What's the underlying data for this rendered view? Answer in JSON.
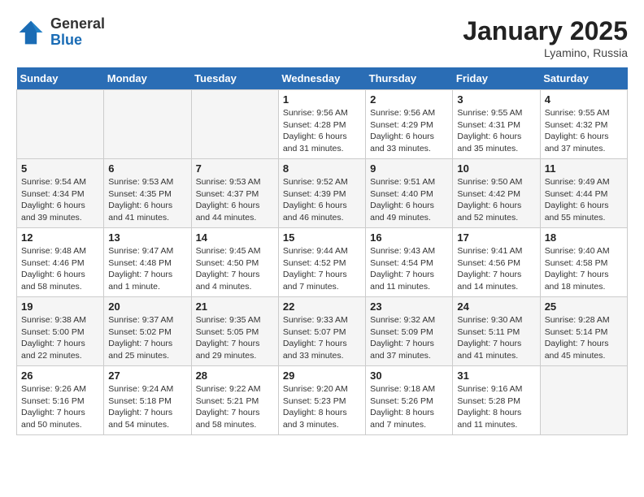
{
  "header": {
    "logo_general": "General",
    "logo_blue": "Blue",
    "month": "January 2025",
    "location": "Lyamino, Russia"
  },
  "weekdays": [
    "Sunday",
    "Monday",
    "Tuesday",
    "Wednesday",
    "Thursday",
    "Friday",
    "Saturday"
  ],
  "weeks": [
    [
      {
        "day": "",
        "info": ""
      },
      {
        "day": "",
        "info": ""
      },
      {
        "day": "",
        "info": ""
      },
      {
        "day": "1",
        "info": "Sunrise: 9:56 AM\nSunset: 4:28 PM\nDaylight: 6 hours\nand 31 minutes."
      },
      {
        "day": "2",
        "info": "Sunrise: 9:56 AM\nSunset: 4:29 PM\nDaylight: 6 hours\nand 33 minutes."
      },
      {
        "day": "3",
        "info": "Sunrise: 9:55 AM\nSunset: 4:31 PM\nDaylight: 6 hours\nand 35 minutes."
      },
      {
        "day": "4",
        "info": "Sunrise: 9:55 AM\nSunset: 4:32 PM\nDaylight: 6 hours\nand 37 minutes."
      }
    ],
    [
      {
        "day": "5",
        "info": "Sunrise: 9:54 AM\nSunset: 4:34 PM\nDaylight: 6 hours\nand 39 minutes."
      },
      {
        "day": "6",
        "info": "Sunrise: 9:53 AM\nSunset: 4:35 PM\nDaylight: 6 hours\nand 41 minutes."
      },
      {
        "day": "7",
        "info": "Sunrise: 9:53 AM\nSunset: 4:37 PM\nDaylight: 6 hours\nand 44 minutes."
      },
      {
        "day": "8",
        "info": "Sunrise: 9:52 AM\nSunset: 4:39 PM\nDaylight: 6 hours\nand 46 minutes."
      },
      {
        "day": "9",
        "info": "Sunrise: 9:51 AM\nSunset: 4:40 PM\nDaylight: 6 hours\nand 49 minutes."
      },
      {
        "day": "10",
        "info": "Sunrise: 9:50 AM\nSunset: 4:42 PM\nDaylight: 6 hours\nand 52 minutes."
      },
      {
        "day": "11",
        "info": "Sunrise: 9:49 AM\nSunset: 4:44 PM\nDaylight: 6 hours\nand 55 minutes."
      }
    ],
    [
      {
        "day": "12",
        "info": "Sunrise: 9:48 AM\nSunset: 4:46 PM\nDaylight: 6 hours\nand 58 minutes."
      },
      {
        "day": "13",
        "info": "Sunrise: 9:47 AM\nSunset: 4:48 PM\nDaylight: 7 hours\nand 1 minute."
      },
      {
        "day": "14",
        "info": "Sunrise: 9:45 AM\nSunset: 4:50 PM\nDaylight: 7 hours\nand 4 minutes."
      },
      {
        "day": "15",
        "info": "Sunrise: 9:44 AM\nSunset: 4:52 PM\nDaylight: 7 hours\nand 7 minutes."
      },
      {
        "day": "16",
        "info": "Sunrise: 9:43 AM\nSunset: 4:54 PM\nDaylight: 7 hours\nand 11 minutes."
      },
      {
        "day": "17",
        "info": "Sunrise: 9:41 AM\nSunset: 4:56 PM\nDaylight: 7 hours\nand 14 minutes."
      },
      {
        "day": "18",
        "info": "Sunrise: 9:40 AM\nSunset: 4:58 PM\nDaylight: 7 hours\nand 18 minutes."
      }
    ],
    [
      {
        "day": "19",
        "info": "Sunrise: 9:38 AM\nSunset: 5:00 PM\nDaylight: 7 hours\nand 22 minutes."
      },
      {
        "day": "20",
        "info": "Sunrise: 9:37 AM\nSunset: 5:02 PM\nDaylight: 7 hours\nand 25 minutes."
      },
      {
        "day": "21",
        "info": "Sunrise: 9:35 AM\nSunset: 5:05 PM\nDaylight: 7 hours\nand 29 minutes."
      },
      {
        "day": "22",
        "info": "Sunrise: 9:33 AM\nSunset: 5:07 PM\nDaylight: 7 hours\nand 33 minutes."
      },
      {
        "day": "23",
        "info": "Sunrise: 9:32 AM\nSunset: 5:09 PM\nDaylight: 7 hours\nand 37 minutes."
      },
      {
        "day": "24",
        "info": "Sunrise: 9:30 AM\nSunset: 5:11 PM\nDaylight: 7 hours\nand 41 minutes."
      },
      {
        "day": "25",
        "info": "Sunrise: 9:28 AM\nSunset: 5:14 PM\nDaylight: 7 hours\nand 45 minutes."
      }
    ],
    [
      {
        "day": "26",
        "info": "Sunrise: 9:26 AM\nSunset: 5:16 PM\nDaylight: 7 hours\nand 50 minutes."
      },
      {
        "day": "27",
        "info": "Sunrise: 9:24 AM\nSunset: 5:18 PM\nDaylight: 7 hours\nand 54 minutes."
      },
      {
        "day": "28",
        "info": "Sunrise: 9:22 AM\nSunset: 5:21 PM\nDaylight: 7 hours\nand 58 minutes."
      },
      {
        "day": "29",
        "info": "Sunrise: 9:20 AM\nSunset: 5:23 PM\nDaylight: 8 hours\nand 3 minutes."
      },
      {
        "day": "30",
        "info": "Sunrise: 9:18 AM\nSunset: 5:26 PM\nDaylight: 8 hours\nand 7 minutes."
      },
      {
        "day": "31",
        "info": "Sunrise: 9:16 AM\nSunset: 5:28 PM\nDaylight: 8 hours\nand 11 minutes."
      },
      {
        "day": "",
        "info": ""
      }
    ]
  ]
}
